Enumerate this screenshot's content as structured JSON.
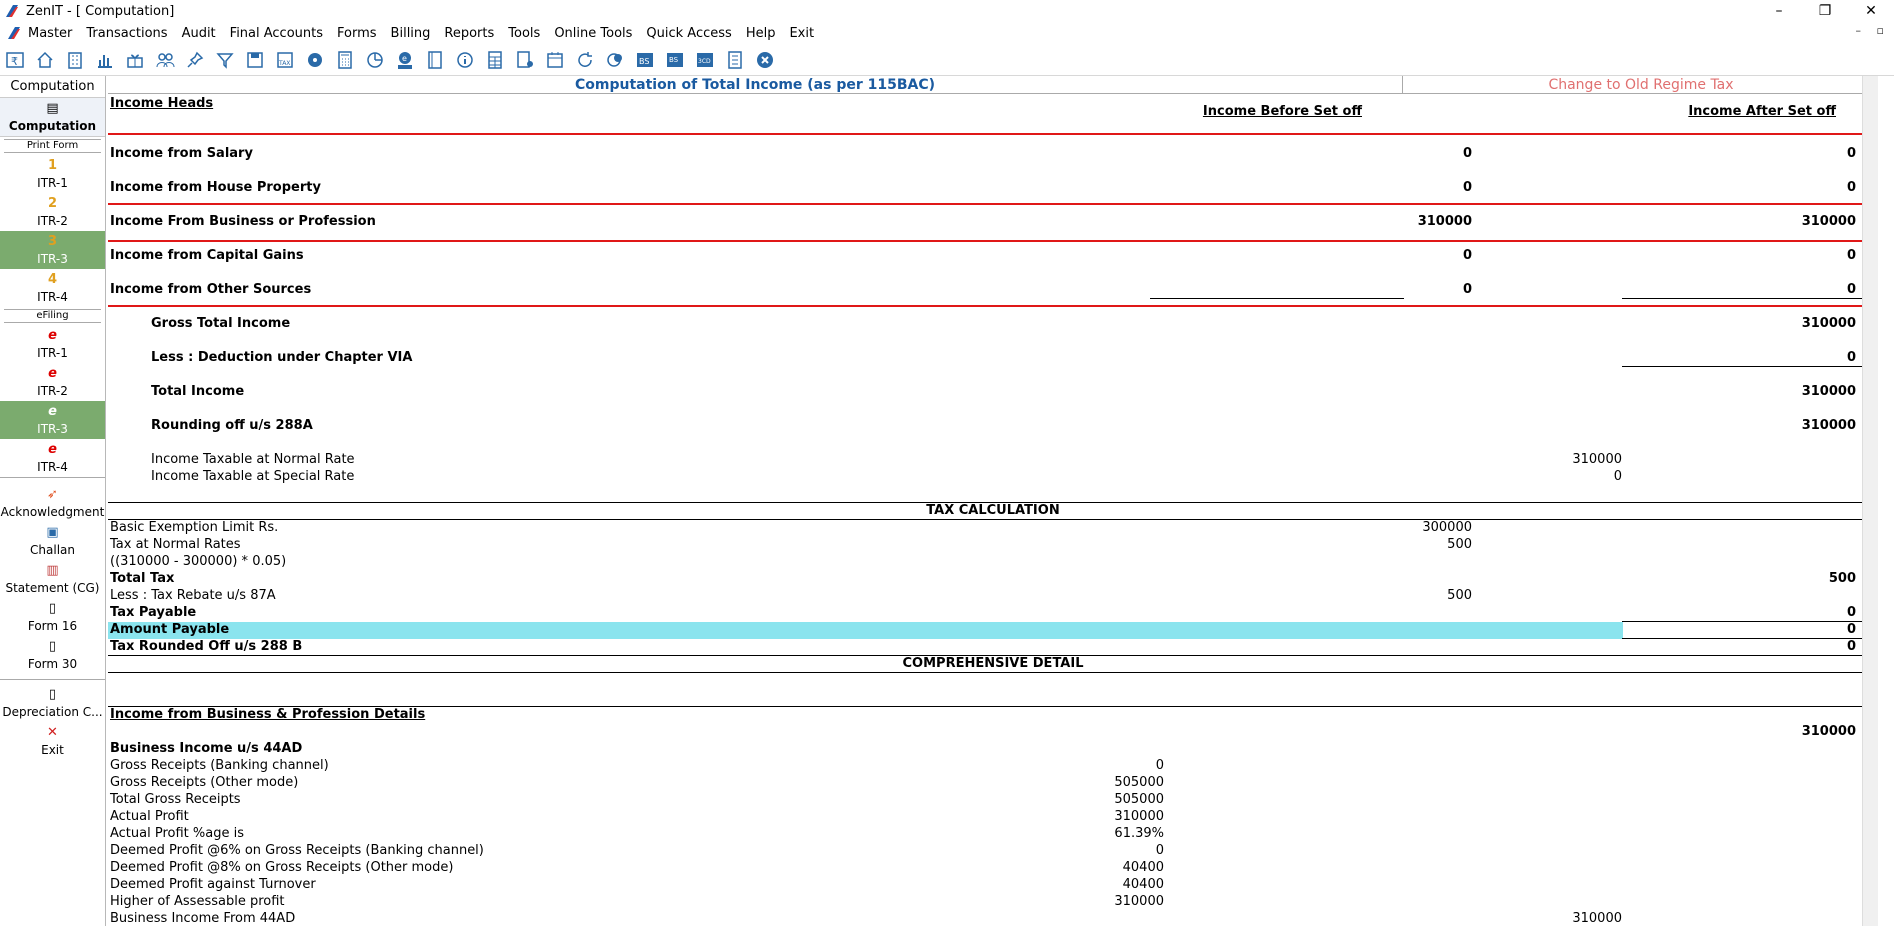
{
  "window": {
    "title": "ZenIT - [ Computation]",
    "min": "–",
    "restore": "❐",
    "close": "✕",
    "mdi_controls": "– ▫"
  },
  "menu": [
    "Master",
    "Transactions",
    "Audit",
    "Final Accounts",
    "Forms",
    "Billing",
    "Reports",
    "Tools",
    "Online Tools",
    "Quick Access",
    "Help",
    "Exit"
  ],
  "sidebar": {
    "head": "Computation",
    "computation": "Computation",
    "print_form": "Print Form",
    "itr_print": [
      {
        "num": "1",
        "label": "ITR-1"
      },
      {
        "num": "2",
        "label": "ITR-2"
      },
      {
        "num": "3",
        "label": "ITR-3"
      },
      {
        "num": "4",
        "label": "ITR-4"
      }
    ],
    "efiling": "eFiling",
    "itr_efile": [
      {
        "icon": "e",
        "label": "ITR-1"
      },
      {
        "icon": "e",
        "label": "ITR-2"
      },
      {
        "icon": "e",
        "label": "ITR-3"
      },
      {
        "icon": "e",
        "label": "ITR-4"
      }
    ],
    "acknowledgment": "Acknowledgment",
    "challan": "Challan",
    "statement": "Statement (CG)",
    "form16": "Form 16",
    "form30": "Form 30",
    "depreciation": "Depreciation C...",
    "exit": "Exit"
  },
  "header": {
    "title": "Computation of Total Income (as per 115BAC)",
    "switch": "Change to Old Regime Tax"
  },
  "heads": {
    "title": "Income Heads",
    "before": "Income Before Set off",
    "after": "Income After Set off"
  },
  "income": [
    {
      "label": "Income from Salary",
      "before": "0",
      "after": "0"
    },
    {
      "label": "Income from House Property",
      "before": "0",
      "after": "0"
    },
    {
      "label": "Income From Business or Profession",
      "before": "310000",
      "after": "310000"
    },
    {
      "label": "Income from Capital Gains",
      "before": "0",
      "after": "0"
    },
    {
      "label": "Income from Other Sources",
      "before": "0",
      "after": "0"
    }
  ],
  "totals": [
    {
      "label": "Gross Total Income",
      "value": "310000"
    },
    {
      "label": "Less : Deduction under Chapter VIA",
      "value": "0"
    },
    {
      "label": "Total Income",
      "value": "310000"
    },
    {
      "label": "Rounding off u/s 288A",
      "value": "310000"
    }
  ],
  "taxable": [
    {
      "label": "Income Taxable at Normal Rate",
      "value": "310000"
    },
    {
      "label": "Income Taxable at Special Rate",
      "value": "0"
    }
  ],
  "tax_calc": {
    "title": "TAX CALCULATION",
    "basic_exemption": {
      "label": "Basic Exemption Limit Rs.",
      "value": "300000"
    },
    "tax_normal": {
      "label": "Tax at Normal Rates",
      "value": "500"
    },
    "formula": "((310000 - 300000) * 0.05)",
    "total_tax": {
      "label": "Total Tax",
      "value": "500"
    },
    "rebate": {
      "label": "Less : Tax Rebate u/s 87A",
      "value": "500"
    },
    "tax_payable": {
      "label": "Tax Payable",
      "value": "0"
    },
    "amount_payable": {
      "label": "Amount Payable",
      "value": "0"
    },
    "rounded": {
      "label": "Tax Rounded Off u/s 288 B",
      "value": "0"
    }
  },
  "comprehensive": {
    "title": "COMPREHENSIVE DETAIL",
    "bp_title": "Income from Business & Profession Details",
    "bp_total": "310000",
    "section": "Business Income u/s 44AD",
    "rows": [
      {
        "label": "Gross Receipts (Banking channel)",
        "value": "0"
      },
      {
        "label": "Gross Receipts (Other mode)",
        "value": "505000"
      },
      {
        "label": "Total Gross Receipts",
        "value": "505000"
      },
      {
        "label": "Actual Profit",
        "value": "310000"
      },
      {
        "label": "Actual Profit %age is",
        "value": "61.39%"
      },
      {
        "label": "Deemed Profit @6% on Gross Receipts (Banking channel)",
        "value": "0"
      },
      {
        "label": "Deemed Profit @8% on Gross Receipts (Other mode)",
        "value": "40400"
      },
      {
        "label": "Deemed Profit against Turnover",
        "value": "40400"
      },
      {
        "label": "Higher of Assessable profit",
        "value": "310000"
      }
    ],
    "final": {
      "label": "Business Income From 44AD",
      "value": "310000"
    }
  }
}
